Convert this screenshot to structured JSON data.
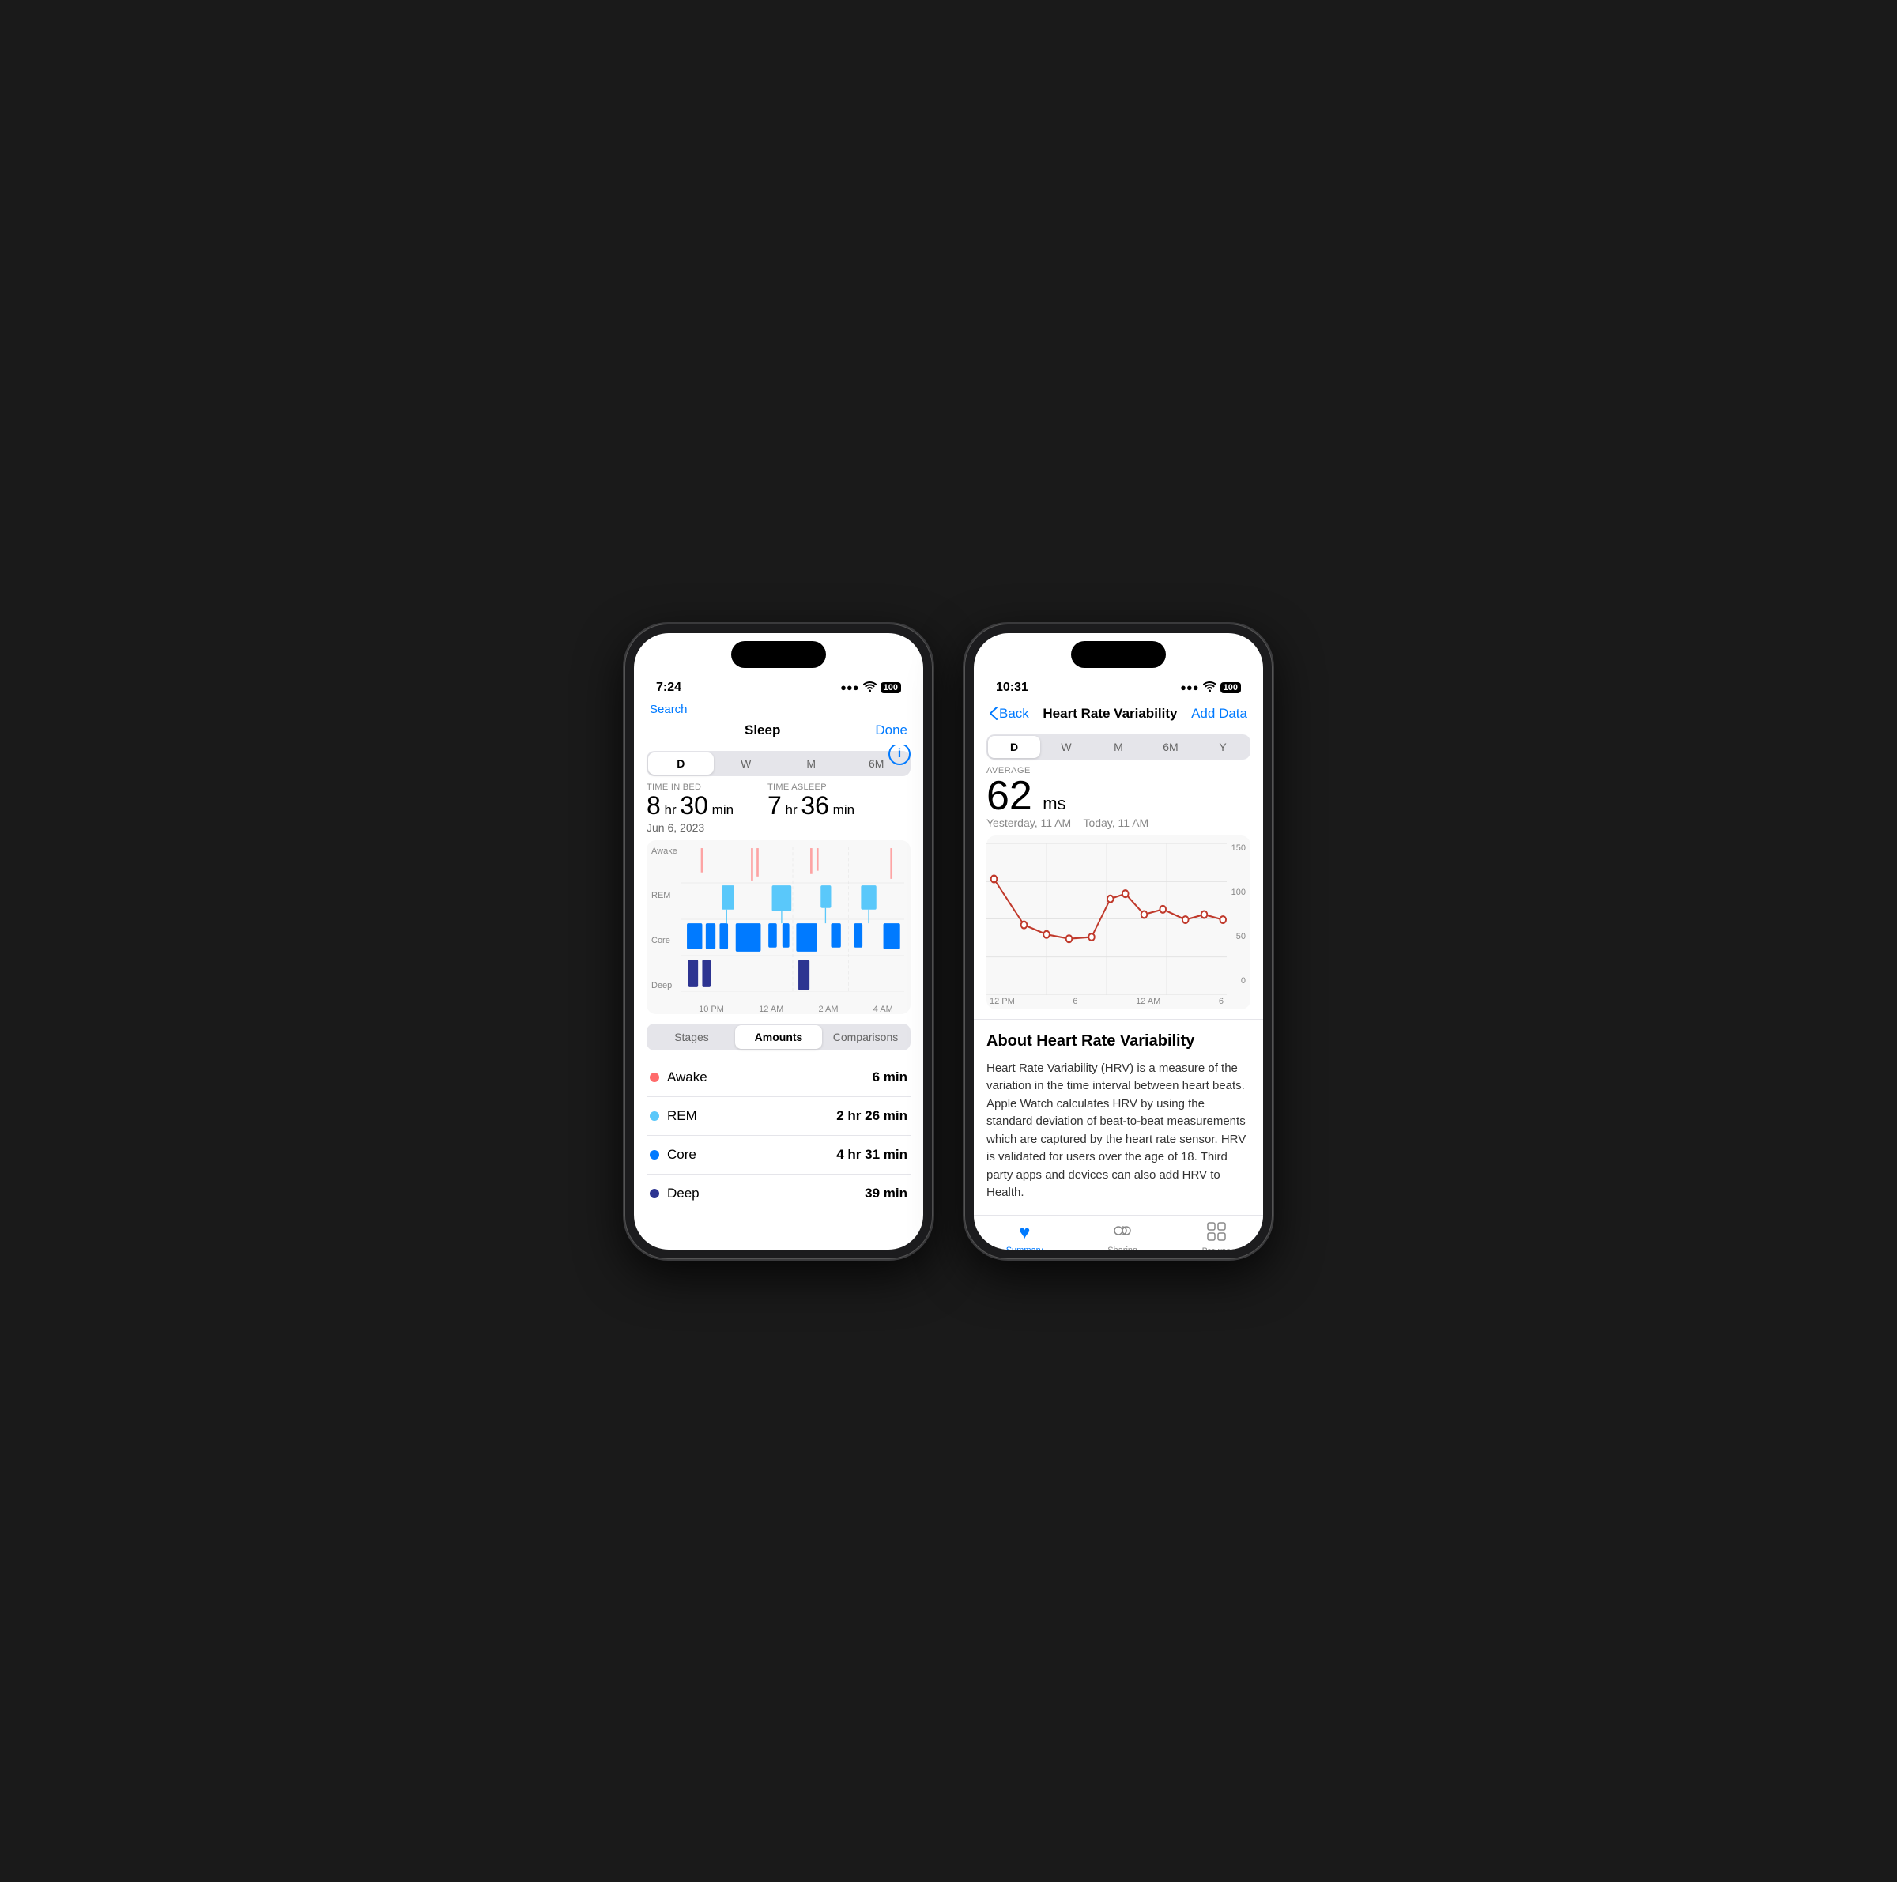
{
  "phone1": {
    "statusBar": {
      "time": "7:24",
      "personIcon": "👤",
      "signal": "▂▄▆",
      "wifi": "wifi",
      "battery": "100"
    },
    "nav": {
      "back": "Search",
      "title": "Sleep",
      "action": "Done"
    },
    "tabs": [
      "D",
      "W",
      "M",
      "6M"
    ],
    "activeTab": "D",
    "timeInBedLabel": "TIME IN BED",
    "timeAsleepLabel": "TIME ASLEEP",
    "timeInBed": {
      "hours": "8",
      "min": "30",
      "unit": "min"
    },
    "timeAsleep": {
      "hours": "7",
      "min": "36",
      "unit": "min"
    },
    "date": "Jun 6, 2023",
    "chartLabels": {
      "yAxis": [
        "Awake",
        "REM",
        "Core",
        "Deep"
      ],
      "xAxis": [
        "10 PM",
        "12 AM",
        "2 AM",
        "4 AM"
      ]
    },
    "bottomTabs": [
      "Stages",
      "Amounts",
      "Comparisons"
    ],
    "activeBottomTab": "Amounts",
    "stages": [
      {
        "name": "Awake",
        "color": "#FF6B6B",
        "duration": "6 min"
      },
      {
        "name": "REM",
        "color": "#5AC8FA",
        "duration": "2 hr 26 min"
      },
      {
        "name": "Core",
        "color": "#007AFF",
        "duration": "4 hr 31 min"
      },
      {
        "name": "Deep",
        "color": "#2D3491",
        "duration": "39 min"
      }
    ]
  },
  "phone2": {
    "statusBar": {
      "time": "10:31",
      "personIcon": "👤",
      "signal": "▂▄▆",
      "wifi": "wifi",
      "battery": "100"
    },
    "nav": {
      "back": "Back",
      "title": "Heart Rate Variability",
      "action": "Add Data"
    },
    "tabs": [
      "D",
      "W",
      "M",
      "6M",
      "Y"
    ],
    "activeTab": "D",
    "averageLabel": "AVERAGE",
    "hrv": {
      "value": "62",
      "unit": "ms"
    },
    "range": "Yesterday, 11 AM – Today, 11 AM",
    "chartYLabels": [
      "150",
      "100",
      "50",
      "0"
    ],
    "chartXLabels": [
      "12 PM",
      "6",
      "12 AM",
      "6"
    ],
    "aboutTitle": "About Heart Rate Variability",
    "aboutText": "Heart Rate Variability (HRV) is a measure of the variation in the time interval between heart beats. Apple Watch calculates HRV by using the standard deviation of beat-to-beat measurements which are captured by the heart rate sensor. HRV is validated for users over the age of 18. Third party apps and devices can also add HRV to Health.",
    "tabBar": {
      "items": [
        {
          "label": "Summary",
          "icon": "♥",
          "active": true
        },
        {
          "label": "Sharing",
          "icon": "👥",
          "active": false
        },
        {
          "label": "Browse",
          "icon": "⊞",
          "active": false
        }
      ]
    }
  }
}
